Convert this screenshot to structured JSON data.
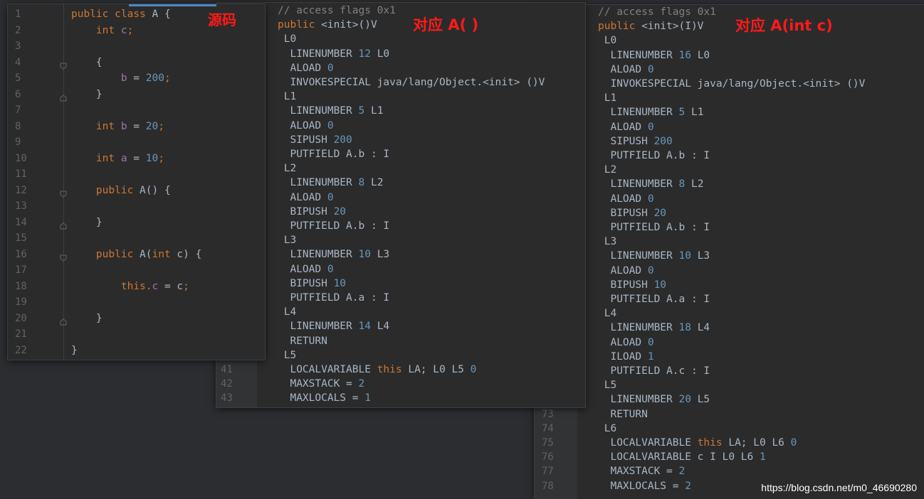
{
  "source": {
    "annotation": "源码",
    "line_numbers": [
      "1",
      "2",
      "3",
      "4",
      "5",
      "6",
      "7",
      "8",
      "9",
      "10",
      "11",
      "12",
      "13",
      "14",
      "15",
      "16",
      "17",
      "18",
      "19",
      "20",
      "21",
      "22"
    ],
    "lines": [
      [
        [
          "kw",
          "public class "
        ],
        [
          "",
          "A {"
        ]
      ],
      [
        [
          "kw",
          "    int "
        ],
        [
          "fld",
          "c"
        ],
        [
          "kw",
          ";"
        ]
      ],
      [],
      [
        [
          "",
          "    {"
        ]
      ],
      [
        [
          "",
          "        "
        ],
        [
          "fld",
          "b"
        ],
        [
          "",
          ""
        ],
        [
          "",
          " = "
        ],
        [
          "num",
          "200"
        ],
        [
          "kw",
          ";"
        ]
      ],
      [
        [
          "",
          "    }"
        ]
      ],
      [],
      [
        [
          "kw",
          "    int "
        ],
        [
          "fld",
          "b"
        ],
        [
          "",
          " = "
        ],
        [
          "num",
          "20"
        ],
        [
          "kw",
          ";"
        ]
      ],
      [],
      [
        [
          "kw",
          "    int "
        ],
        [
          "fld",
          "a"
        ],
        [
          "",
          " = "
        ],
        [
          "num",
          "10"
        ],
        [
          "kw",
          ";"
        ]
      ],
      [],
      [
        [
          "kw",
          "    public "
        ],
        [
          "",
          "A() {"
        ]
      ],
      [],
      [
        [
          "",
          "    }"
        ]
      ],
      [],
      [
        [
          "kw",
          "    public "
        ],
        [
          "",
          "A("
        ],
        [
          "kw",
          "int "
        ],
        [
          "",
          "c) {"
        ]
      ],
      [],
      [
        [
          "kw",
          "        this"
        ],
        [
          "",
          ""
        ],
        [
          "kw",
          "."
        ],
        [
          "fld",
          "c"
        ],
        [
          "",
          " = c"
        ],
        [
          "kw",
          ";"
        ]
      ],
      [],
      [
        [
          "",
          "    }"
        ]
      ],
      [],
      [
        [
          "",
          "}"
        ]
      ]
    ]
  },
  "bytecode_a": {
    "annotation": "对应 A( )",
    "line_numbers": [
      "41",
      "42",
      "43"
    ],
    "lines": [
      [
        [
          "cmt",
          "// access flags 0x1"
        ]
      ],
      [
        [
          "kw",
          "public "
        ],
        [
          "",
          "<init>()V"
        ]
      ],
      [
        [
          "",
          " L0"
        ]
      ],
      [
        [
          "",
          "  LINENUMBER "
        ],
        [
          "num",
          "12"
        ],
        [
          "",
          " L0"
        ]
      ],
      [
        [
          "",
          "  ALOAD "
        ],
        [
          "num",
          "0"
        ]
      ],
      [
        [
          "",
          "  INVOKESPECIAL java/lang/Object.<init> ()V"
        ]
      ],
      [
        [
          "",
          " L1"
        ]
      ],
      [
        [
          "",
          "  LINENUMBER "
        ],
        [
          "num",
          "5"
        ],
        [
          "",
          " L1"
        ]
      ],
      [
        [
          "",
          "  ALOAD "
        ],
        [
          "num",
          "0"
        ]
      ],
      [
        [
          "",
          "  SIPUSH "
        ],
        [
          "num",
          "200"
        ]
      ],
      [
        [
          "",
          "  PUTFIELD A.b : I"
        ]
      ],
      [
        [
          "",
          " L2"
        ]
      ],
      [
        [
          "",
          "  LINENUMBER "
        ],
        [
          "num",
          "8"
        ],
        [
          "",
          " L2"
        ]
      ],
      [
        [
          "",
          "  ALOAD "
        ],
        [
          "num",
          "0"
        ]
      ],
      [
        [
          "",
          "  BIPUSH "
        ],
        [
          "num",
          "20"
        ]
      ],
      [
        [
          "",
          "  PUTFIELD A.b : I"
        ]
      ],
      [
        [
          "",
          " L3"
        ]
      ],
      [
        [
          "",
          "  LINENUMBER "
        ],
        [
          "num",
          "10"
        ],
        [
          "",
          " L3"
        ]
      ],
      [
        [
          "",
          "  ALOAD "
        ],
        [
          "num",
          "0"
        ]
      ],
      [
        [
          "",
          "  BIPUSH "
        ],
        [
          "num",
          "10"
        ]
      ],
      [
        [
          "",
          "  PUTFIELD A.a : I"
        ]
      ],
      [
        [
          "",
          " L4"
        ]
      ],
      [
        [
          "",
          "  LINENUMBER "
        ],
        [
          "num",
          "14"
        ],
        [
          "",
          " L4"
        ]
      ],
      [
        [
          "",
          "  RETURN"
        ]
      ],
      [
        [
          "",
          " L5"
        ]
      ],
      [
        [
          "",
          "  LOCALVARIABLE "
        ],
        [
          "kw",
          "this "
        ],
        [
          "",
          "LA; L0 L5 "
        ],
        [
          "num",
          "0"
        ]
      ],
      [
        [
          "",
          "  MAXSTACK = "
        ],
        [
          "num",
          "2"
        ]
      ],
      [
        [
          "",
          "  MAXLOCALS = "
        ],
        [
          "num",
          "1"
        ]
      ]
    ]
  },
  "bytecode_b": {
    "annotation": "对应 A(int c)",
    "line_numbers": [
      "73",
      "74",
      "75",
      "76",
      "77",
      "78"
    ],
    "lines": [
      [
        [
          "cmt",
          "// access flags 0x1"
        ]
      ],
      [
        [
          "kw",
          "public "
        ],
        [
          "",
          "<init>(I)V"
        ]
      ],
      [
        [
          "",
          " L0"
        ]
      ],
      [
        [
          "",
          "  LINENUMBER "
        ],
        [
          "num",
          "16"
        ],
        [
          "",
          " L0"
        ]
      ],
      [
        [
          "",
          "  ALOAD "
        ],
        [
          "num",
          "0"
        ]
      ],
      [
        [
          "",
          "  INVOKESPECIAL java/lang/Object.<init> ()V"
        ]
      ],
      [
        [
          "",
          " L1"
        ]
      ],
      [
        [
          "",
          "  LINENUMBER "
        ],
        [
          "num",
          "5"
        ],
        [
          "",
          " L1"
        ]
      ],
      [
        [
          "",
          "  ALOAD "
        ],
        [
          "num",
          "0"
        ]
      ],
      [
        [
          "",
          "  SIPUSH "
        ],
        [
          "num",
          "200"
        ]
      ],
      [
        [
          "",
          "  PUTFIELD A.b : I"
        ]
      ],
      [
        [
          "",
          " L2"
        ]
      ],
      [
        [
          "",
          "  LINENUMBER "
        ],
        [
          "num",
          "8"
        ],
        [
          "",
          " L2"
        ]
      ],
      [
        [
          "",
          "  ALOAD "
        ],
        [
          "num",
          "0"
        ]
      ],
      [
        [
          "",
          "  BIPUSH "
        ],
        [
          "num",
          "20"
        ]
      ],
      [
        [
          "",
          "  PUTFIELD A.b : I"
        ]
      ],
      [
        [
          "",
          " L3"
        ]
      ],
      [
        [
          "",
          "  LINENUMBER "
        ],
        [
          "num",
          "10"
        ],
        [
          "",
          " L3"
        ]
      ],
      [
        [
          "",
          "  ALOAD "
        ],
        [
          "num",
          "0"
        ]
      ],
      [
        [
          "",
          "  BIPUSH "
        ],
        [
          "num",
          "10"
        ]
      ],
      [
        [
          "",
          "  PUTFIELD A.a : I"
        ]
      ],
      [
        [
          "",
          " L4"
        ]
      ],
      [
        [
          "",
          "  LINENUMBER "
        ],
        [
          "num",
          "18"
        ],
        [
          "",
          " L4"
        ]
      ],
      [
        [
          "",
          "  ALOAD "
        ],
        [
          "num",
          "0"
        ]
      ],
      [
        [
          "",
          "  ILOAD "
        ],
        [
          "num",
          "1"
        ]
      ],
      [
        [
          "",
          "  PUTFIELD A.c : I"
        ]
      ],
      [
        [
          "",
          " L5"
        ]
      ],
      [
        [
          "",
          "  LINENUMBER "
        ],
        [
          "num",
          "20"
        ],
        [
          "",
          " L5"
        ]
      ],
      [
        [
          "",
          "  RETURN"
        ]
      ],
      [
        [
          "",
          " L6"
        ]
      ],
      [
        [
          "",
          "  LOCALVARIABLE "
        ],
        [
          "kw",
          "this "
        ],
        [
          "",
          "LA; L0 L6 "
        ],
        [
          "num",
          "0"
        ]
      ],
      [
        [
          "",
          "  LOCALVARIABLE c I L0 L6 "
        ],
        [
          "num",
          "1"
        ]
      ],
      [
        [
          "",
          "  MAXSTACK = "
        ],
        [
          "num",
          "2"
        ]
      ],
      [
        [
          "",
          "  MAXLOCALS = "
        ],
        [
          "num",
          "2"
        ]
      ]
    ]
  },
  "watermark": "https://blog.csdn.net/m0_46690280"
}
